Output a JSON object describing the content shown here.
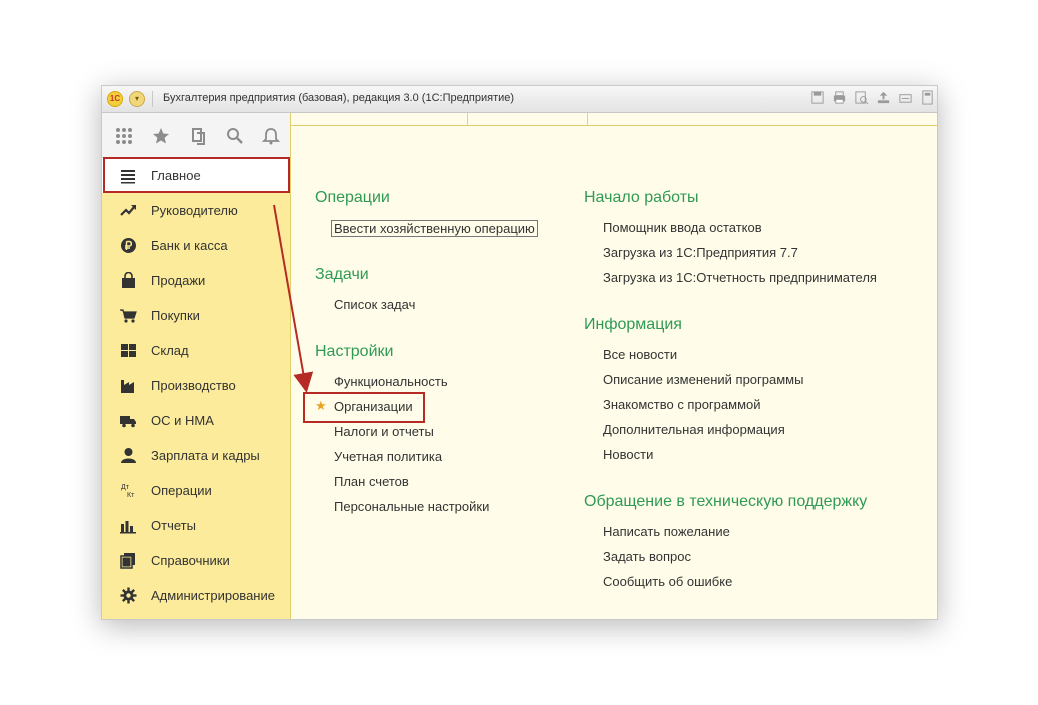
{
  "window": {
    "title": "Бухгалтерия предприятия (базовая), редакция 3.0  (1С:Предприятие)",
    "logo_text": "1С"
  },
  "sidebar": {
    "items": [
      {
        "label": "Главное",
        "icon": "menu-lines-icon",
        "active": true
      },
      {
        "label": "Руководителю",
        "icon": "trend-up-icon"
      },
      {
        "label": "Банк и касса",
        "icon": "ruble-coin-icon"
      },
      {
        "label": "Продажи",
        "icon": "shopping-bag-icon"
      },
      {
        "label": "Покупки",
        "icon": "shopping-cart-icon"
      },
      {
        "label": "Склад",
        "icon": "warehouse-grid-icon"
      },
      {
        "label": "Производство",
        "icon": "factory-icon"
      },
      {
        "label": "ОС и НМА",
        "icon": "truck-icon"
      },
      {
        "label": "Зарплата и кадры",
        "icon": "person-icon"
      },
      {
        "label": "Операции",
        "icon": "debit-credit-icon",
        "icon_text_top": "Дт",
        "icon_text_bottom": "Кт"
      },
      {
        "label": "Отчеты",
        "icon": "bar-chart-icon"
      },
      {
        "label": "Справочники",
        "icon": "books-icon"
      },
      {
        "label": "Администрирование",
        "icon": "gear-icon"
      }
    ]
  },
  "left_column": {
    "sections": [
      {
        "title": "Операции",
        "links": [
          "Ввести хозяйственную операцию"
        ]
      },
      {
        "title": "Задачи",
        "links": [
          "Список задач"
        ]
      },
      {
        "title": "Настройки",
        "links": [
          "Функциональность",
          "Организации",
          "Налоги и отчеты",
          "Учетная политика",
          "План счетов",
          "Персональные настройки"
        ]
      }
    ]
  },
  "right_column": {
    "sections": [
      {
        "title": "Начало работы",
        "links": [
          "Помощник ввода остатков",
          "Загрузка из 1С:Предприятия 7.7",
          "Загрузка из 1С:Отчетность предпринимателя"
        ]
      },
      {
        "title": "Информация",
        "links": [
          "Все новости",
          "Описание изменений программы",
          "Знакомство с программой",
          "Дополнительная информация",
          "Новости"
        ]
      },
      {
        "title": "Обращение в техническую поддержку",
        "links": [
          "Написать пожелание",
          "Задать вопрос",
          "Сообщить об ошибке"
        ]
      }
    ]
  },
  "colors": {
    "accent_green": "#2f9a54",
    "sidebar_bg": "#fbeb9b",
    "content_bg": "#fffde9",
    "annotation_red": "#b62a26",
    "favorite_star": "#e8a327"
  }
}
